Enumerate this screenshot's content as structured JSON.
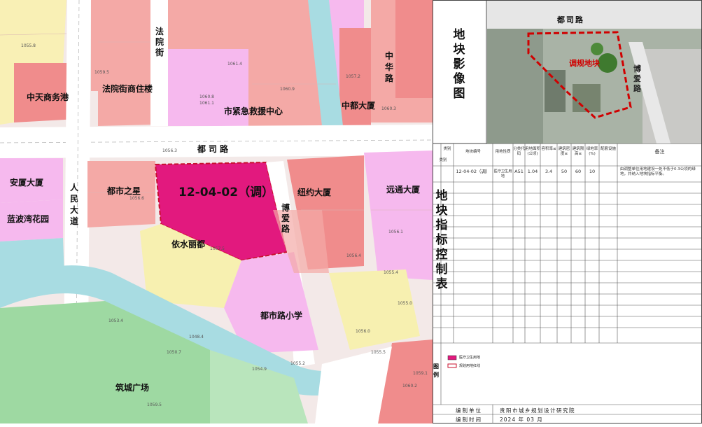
{
  "map": {
    "parcel_label": "12-04-02（调）",
    "landmarks": {
      "zhongtian": "中天商务港",
      "fayuanjie": "法院街",
      "fayuanjie_zhuzhai": "法院街商住楼",
      "shijinji": "市紧急救援中心",
      "zhongdu": "中都大厦",
      "zhonghua_road": "中华路",
      "dusi_road": "都司路",
      "anxia": "安厦大厦",
      "renmin_road": "人民大道",
      "dushizhixing": "都市之星",
      "niuyue": "纽约大厦",
      "yuantong": "远通大厦",
      "boai_road": "博爱路",
      "lanbo": "蓝波湾花园",
      "yishuili": "依水丽都",
      "dushilu_xiaoxue": "都市路小学",
      "zhucheng": "筑城广场"
    },
    "elevations": [
      "1055.8",
      "1059.5",
      "1061.4",
      "1060.8",
      "1061.1",
      "1060.9",
      "1057.2",
      "1060.3",
      "1056.3",
      "1056.6",
      "1057.5",
      "1056.4",
      "1056.1",
      "1055.4",
      "1055.0",
      "1053.4",
      "1056.0",
      "1050.7",
      "1048.4",
      "1054.9",
      "1055.2",
      "1055.5",
      "1059.1",
      "1060.2",
      "1059.5"
    ]
  },
  "panel": {
    "image_title": "地块影像图",
    "image_road_top": "都司路",
    "image_road_right": "博爱路",
    "image_parcel_label": "调规地块",
    "table_title": "地块指标控制表",
    "headers": [
      "类别",
      "地块编号",
      "用地性质",
      "分类代码",
      "用地面积(公顷)",
      "容积率≤",
      "建筑密度≤",
      "建筑限高≤",
      "绿地率(%)",
      "配套设施",
      "备注"
    ],
    "row": {
      "category": "类别",
      "id": "12-04-02（调）",
      "usage": "医疗卫生用地",
      "code": "A51",
      "area": "1.04",
      "far": "3.4",
      "density": "50",
      "height": "60",
      "green": "10",
      "facilities": "",
      "note": "由调整单位用地建设一处不低于0.3公顷的绿地，并纳入地块指标平衡。"
    },
    "legend_title": "图例",
    "legend_items": [
      {
        "label": "医疗卫生用地",
        "color": "#e2197e"
      },
      {
        "label": "规划用地红线",
        "color": "#c8102e"
      }
    ],
    "compiler_label": "编制单位",
    "compiler_value": "贵阳市城乡规划设计研究院",
    "date_label": "编制时间",
    "date_value": "2024 年 03 月"
  },
  "colors": {
    "residential": "#f4a9a6",
    "commercial": "#f08c8c",
    "medical": "#e2197e",
    "education": "#f6b9ee",
    "housing_yellow": "#f7f0b0",
    "green": "#9ed9a2",
    "water": "#a8dce2",
    "road": "#ffffff"
  }
}
